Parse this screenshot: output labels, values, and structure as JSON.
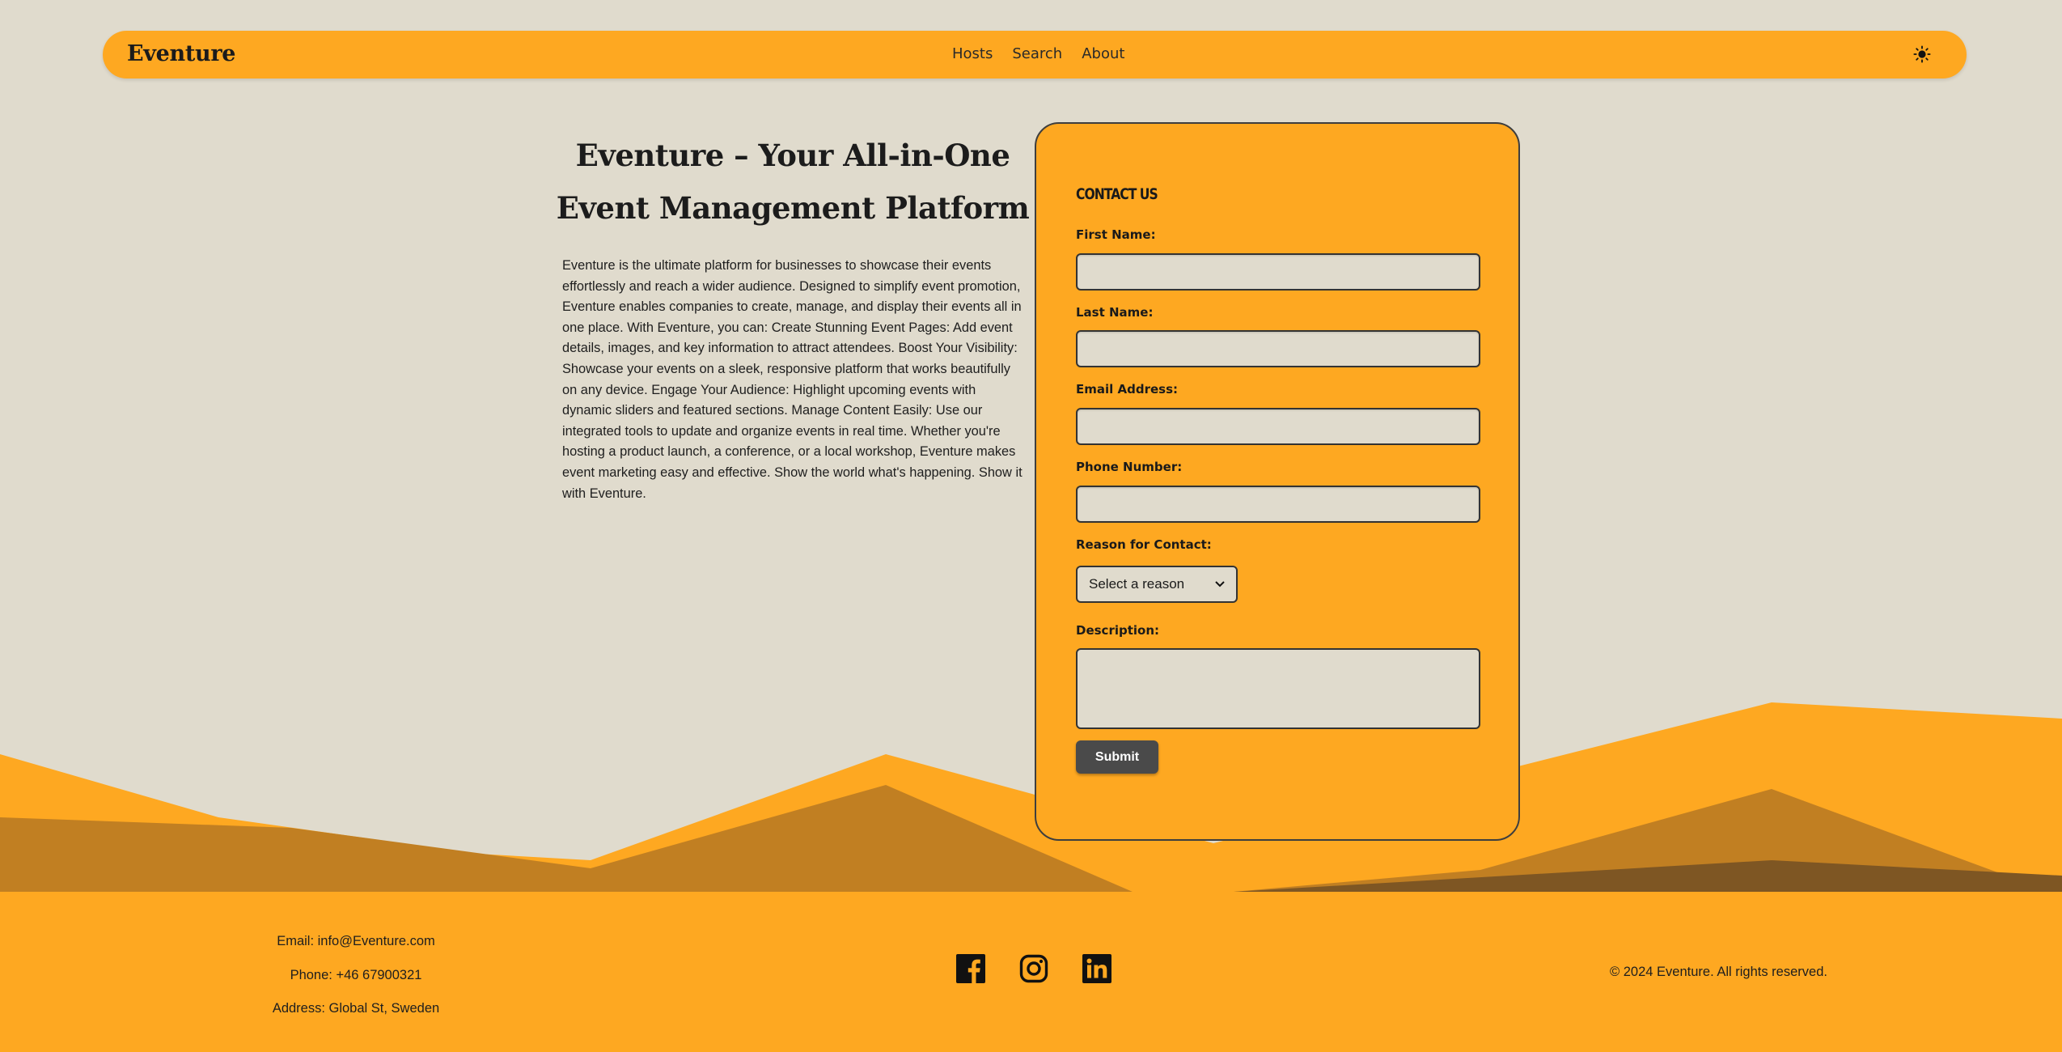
{
  "brand": "Eventure",
  "nav": {
    "links": [
      "Hosts",
      "Search",
      "About"
    ],
    "theme_icon": "sun-icon"
  },
  "hero": {
    "title_line1": "Eventure – Your All-in-One",
    "title_line2": "Event Management Platform",
    "description": "Eventure is the ultimate platform for businesses to showcase their events effortlessly and reach a wider audience. Designed to simplify event promotion, Eventure enables companies to create, manage, and display their events all in one place. With Eventure, you can: Create Stunning Event Pages: Add event details, images, and key information to attract attendees. Boost Your Visibility: Showcase your events on a sleek, responsive platform that works beautifully on any device. Engage Your Audience: Highlight upcoming events with dynamic sliders and featured sections. Manage Content Easily: Use our integrated tools to update and organize events in real time. Whether you're hosting a product launch, a conference, or a local workshop, Eventure makes event marketing easy and effective. Show the world what's happening. Show it with Eventure."
  },
  "form": {
    "heading": "CONTACT US",
    "first_name_label": "First Name:",
    "last_name_label": "Last Name:",
    "email_label": "Email Address:",
    "phone_label": "Phone Number:",
    "reason_label": "Reason for Contact:",
    "reason_selected": "Select a reason",
    "description_label": "Description:",
    "submit_label": "Submit",
    "first_name_value": "",
    "last_name_value": "",
    "email_value": "",
    "phone_value": "",
    "description_value": ""
  },
  "footer": {
    "email": "Email: info@Eventure.com",
    "phone": "Phone: +46 67900321",
    "address": "Address: Global St, Sweden",
    "socials": [
      "facebook-icon",
      "instagram-icon",
      "linkedin-icon"
    ],
    "copyright": "© 2024 Eventure. All rights reserved."
  },
  "colors": {
    "background": "#e0dbcd",
    "accent": "#fea821",
    "mountain_mid": "#c17f22",
    "mountain_dark": "#7e5623",
    "button": "#4a4a4a",
    "text": "#1d1d1d"
  }
}
